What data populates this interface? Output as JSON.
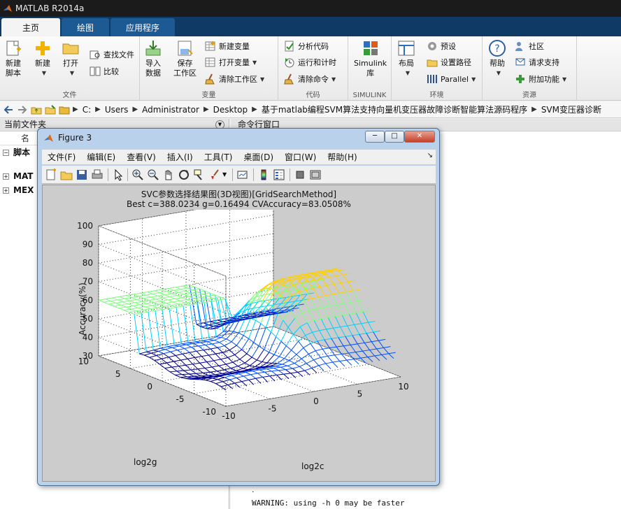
{
  "app": {
    "title": "MATLAB R2014a"
  },
  "ribbon_tabs": [
    "主页",
    "绘图",
    "应用程序"
  ],
  "ribbon": {
    "file": {
      "label": "文件",
      "new_script": [
        "新建",
        "脚本"
      ],
      "new": "新建",
      "open": "打开",
      "find_files": "查找文件",
      "compare": "比较"
    },
    "variable": {
      "label": "变量",
      "import": [
        "导入",
        "数据"
      ],
      "save_ws": [
        "保存",
        "工作区"
      ],
      "new_var": "新建变量",
      "open_var": "打开变量",
      "clear_ws": "清除工作区"
    },
    "code": {
      "label": "代码",
      "analyze": "分析代码",
      "run_time": "运行和计时",
      "clear_cmd": "清除命令"
    },
    "simulink": {
      "label": "SIMULINK",
      "btn": [
        "Simulink",
        "库"
      ]
    },
    "env": {
      "label": "环境",
      "layout": "布局",
      "prefs": "预设",
      "set_path": "设置路径",
      "parallel": "Parallel"
    },
    "resources": {
      "label": "资源",
      "help": "帮助",
      "community": "社区",
      "request_support": "请求支持",
      "addons": "附加功能"
    }
  },
  "breadcrumb": [
    "C:",
    "Users",
    "Administrator",
    "Desktop",
    "基于matlab编程SVM算法支持向量机变压器故障诊断智能算法源码程序",
    "SVM变压器诊断"
  ],
  "left_panel": {
    "title": "当前文件夹",
    "col_header": "名",
    "items": [
      "脚本",
      "MAT",
      "MEX"
    ]
  },
  "cmd": {
    "title": "命令行窗口",
    "dot": ".",
    "warning": "WARNING: using -h 0 may be faster"
  },
  "figure": {
    "title": "Figure 3",
    "menus": [
      "文件(F)",
      "编辑(E)",
      "查看(V)",
      "插入(I)",
      "工具(T)",
      "桌面(D)",
      "窗口(W)",
      "帮助(H)"
    ],
    "menu_end": "↘",
    "controls": {
      "min": "─",
      "max": "□",
      "close": "✕"
    }
  },
  "chart_data": {
    "type": "surface",
    "title": "SVC参数选择结果图(3D视图)[GridSearchMethod]",
    "subtitle": "Best c=388.0234 g=0.16494 CVAccuracy=83.0508%",
    "xlabel": "log2c",
    "ylabel": "log2g",
    "zlabel": "Accuracy(%)",
    "x_ticks": [
      "-10",
      "-5",
      "0",
      "5",
      "10"
    ],
    "y_ticks": [
      "10",
      "5",
      "0",
      "-5",
      "-10"
    ],
    "z_ticks": [
      "30",
      "40",
      "50",
      "60",
      "70",
      "80",
      "90",
      "100"
    ],
    "xlim": [
      -10,
      10
    ],
    "ylim": [
      -10,
      10
    ],
    "zlim": [
      30,
      100
    ],
    "colormap": [
      "#00008f",
      "#0050ff",
      "#00d0ff",
      "#80ff80",
      "#ffd000",
      "#ff3000",
      "#800000"
    ]
  }
}
